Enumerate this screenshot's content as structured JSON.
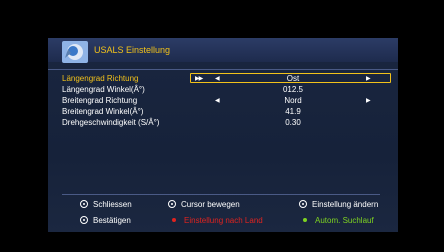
{
  "header": {
    "title": "USALS Einstellung"
  },
  "rows": [
    {
      "label": "Längengrad Richtung",
      "value": "Ost",
      "selected": true
    },
    {
      "label": "Längengrad Winkel(Â°)",
      "value": "012.5"
    },
    {
      "label": "Breitengrad Richtung",
      "value": "Nord"
    },
    {
      "label": "Breitengrad Winkel(Â°)",
      "value": "41.9"
    },
    {
      "label": "Drehgeschwindigkeit (S/Â°)",
      "value": "0.30"
    }
  ],
  "help": {
    "close": "Schliessen",
    "cursor": "Cursor bewegen",
    "change": "Einstellung ändern",
    "confirm": "Bestätigen",
    "by_country": "Einstellung nach Land",
    "auto_search": "Autom. Suchlauf"
  },
  "colors": {
    "accent": "#f2c21a",
    "red": "#e0231f",
    "green": "#7ed321",
    "panel": "#1a2640"
  }
}
